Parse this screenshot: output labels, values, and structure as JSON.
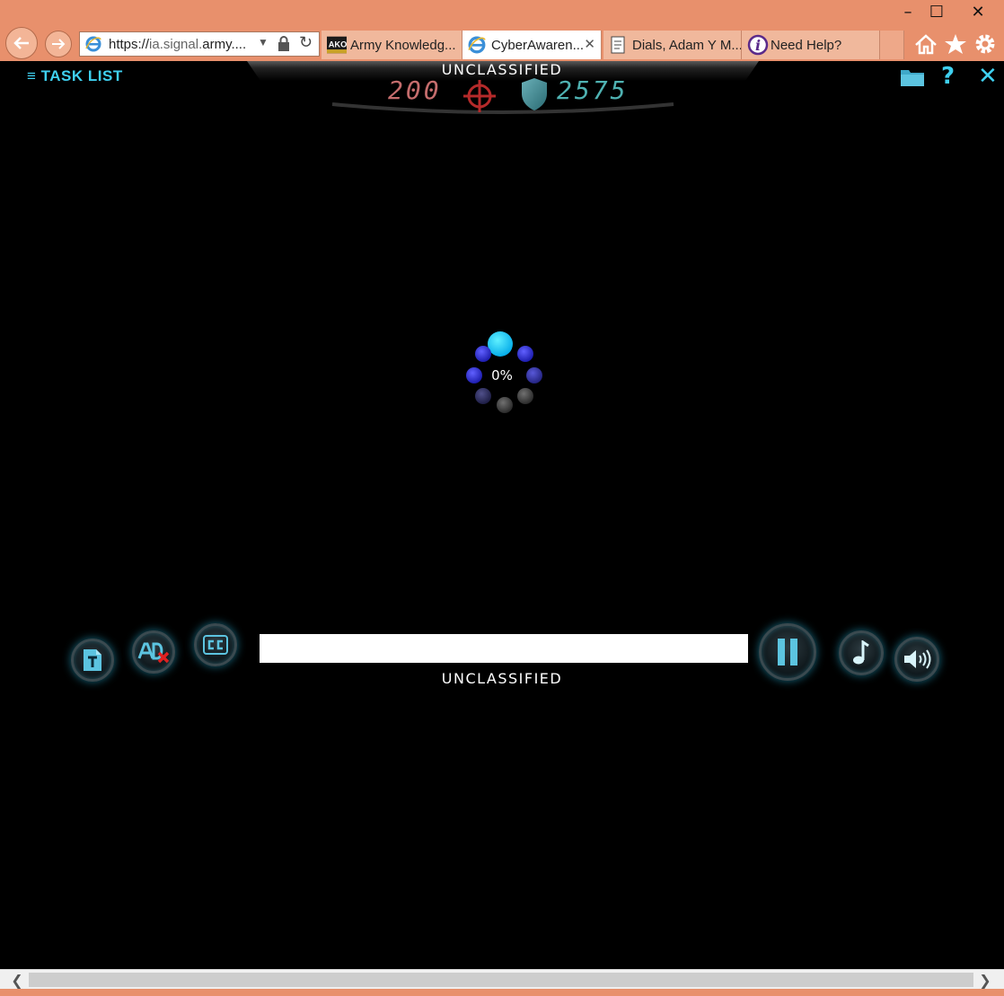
{
  "browser": {
    "address": {
      "url_prefix": "https://",
      "url_gray": "ia.signal.",
      "url_rest": "army...."
    },
    "tabs": [
      {
        "label": "Army Knowledg...",
        "icon": "ako-logo"
      },
      {
        "label": "CyberAwaren...",
        "icon": "ie-icon",
        "active": true
      },
      {
        "label": "Dials, Adam Y M...",
        "icon": "page-icon"
      },
      {
        "label": "Need Help?",
        "icon": "info-icon"
      }
    ],
    "ako_text": "AKO",
    "controls": {
      "minimize": "–",
      "maximize": "☐",
      "close": "✕"
    }
  },
  "game": {
    "task_list_label": "TASK LIST",
    "classification_top": "UNCLASSIFIED",
    "classification_bottom": "UNCLASSIFIED",
    "score_attack": "200",
    "score_defense": "2575",
    "loading_percent": "0%",
    "accent_color": "#3fd0f0"
  }
}
